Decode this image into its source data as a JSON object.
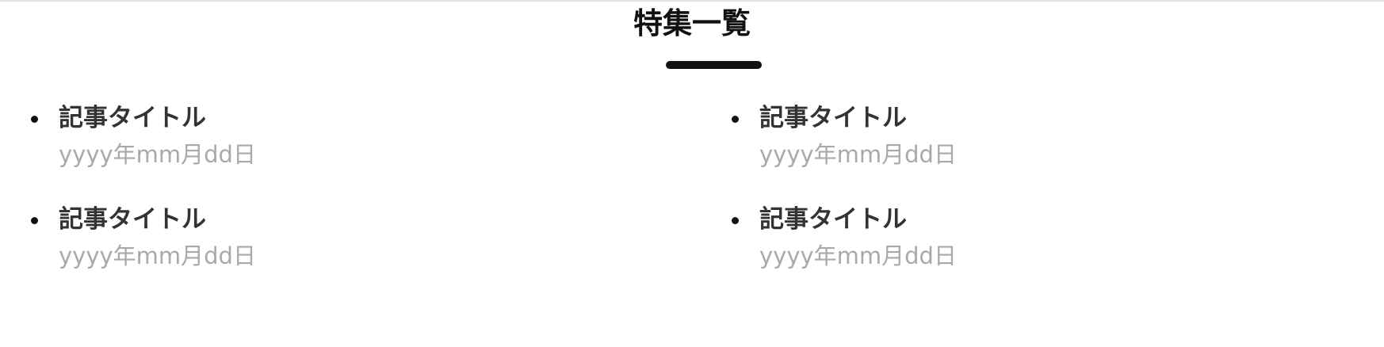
{
  "section": {
    "title": "特集一覧"
  },
  "articles": [
    {
      "title": "記事タイトル",
      "date": "yyyy年mm月dd日"
    },
    {
      "title": "記事タイトル",
      "date": "yyyy年mm月dd日"
    },
    {
      "title": "記事タイトル",
      "date": "yyyy年mm月dd日"
    },
    {
      "title": "記事タイトル",
      "date": "yyyy年mm月dd日"
    }
  ],
  "colors": {
    "heading": "#111111",
    "article_title": "#333333",
    "article_date": "#a9a9a9",
    "top_border": "#e2e2e2"
  }
}
